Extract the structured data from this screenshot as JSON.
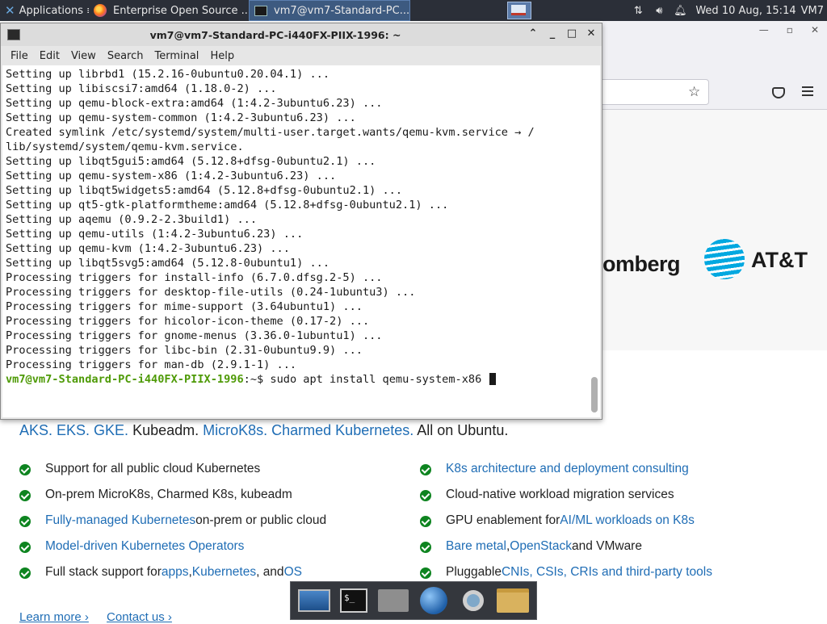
{
  "top_panel": {
    "apps_label": "Applications",
    "apps_suffix": "≡",
    "task_firefox": "Enterprise Open Source ...",
    "task_terminal": "vm7@vm7-Standard-PC...",
    "clock": "Wed 10 Aug, 15:14",
    "user": "VM7",
    "tray_icons": [
      "network-icon",
      "volume-icon",
      "notification-bell-icon"
    ]
  },
  "browser": {
    "logos": {
      "bloomberg_partial": "omberg",
      "att": "AT&T"
    },
    "heading": {
      "part1": "AKS. EKS. GKE.",
      "part2": " Kubeadm. ",
      "part3": "MicroK8s. Charmed Kubernetes.",
      "part4": " All on Ubuntu."
    },
    "features_left": [
      {
        "plain": "Support for all public cloud Kubernetes"
      },
      {
        "plain": "On-prem MicroK8s, Charmed K8s, kubeadm"
      },
      {
        "link": "Fully-managed Kubernetes",
        "plain": " on-prem or public cloud"
      },
      {
        "link": "Model-driven Kubernetes Operators"
      },
      {
        "plain": "Full stack support for ",
        "link": "apps",
        "plain2": ", ",
        "link2": "Kubernetes",
        "plain3": ", and ",
        "link3": "OS"
      }
    ],
    "features_right": [
      {
        "link": "K8s architecture and deployment consulting"
      },
      {
        "plain": "Cloud-native workload migration services"
      },
      {
        "plain": "GPU enablement for ",
        "link": "AI/ML workloads on K8s"
      },
      {
        "link": "Bare metal",
        "plain": ", ",
        "link2": "OpenStack",
        "plain2": " and VMware"
      },
      {
        "plain": "Pluggable ",
        "link": "CNIs, CSIs, CRIs and third-party tools"
      }
    ],
    "learn_more": "Learn more ›",
    "contact_us": "Contact us ›"
  },
  "terminal": {
    "title": "vm7@vm7-Standard-PC-i440FX-PIIX-1996: ~",
    "menu": [
      "File",
      "Edit",
      "View",
      "Search",
      "Terminal",
      "Help"
    ],
    "lines": [
      "Setting up librbd1 (15.2.16-0ubuntu0.20.04.1) ...",
      "Setting up libiscsi7:amd64 (1.18.0-2) ...",
      "Setting up qemu-block-extra:amd64 (1:4.2-3ubuntu6.23) ...",
      "Setting up qemu-system-common (1:4.2-3ubuntu6.23) ...",
      "Created symlink /etc/systemd/system/multi-user.target.wants/qemu-kvm.service → /",
      "lib/systemd/system/qemu-kvm.service.",
      "Setting up libqt5gui5:amd64 (5.12.8+dfsg-0ubuntu2.1) ...",
      "Setting up qemu-system-x86 (1:4.2-3ubuntu6.23) ...",
      "Setting up libqt5widgets5:amd64 (5.12.8+dfsg-0ubuntu2.1) ...",
      "Setting up qt5-gtk-platformtheme:amd64 (5.12.8+dfsg-0ubuntu2.1) ...",
      "Setting up aqemu (0.9.2-2.3build1) ...",
      "Setting up qemu-utils (1:4.2-3ubuntu6.23) ...",
      "Setting up qemu-kvm (1:4.2-3ubuntu6.23) ...",
      "Setting up libqt5svg5:amd64 (5.12.8-0ubuntu1) ...",
      "Processing triggers for install-info (6.7.0.dfsg.2-5) ...",
      "Processing triggers for desktop-file-utils (0.24-1ubuntu3) ...",
      "Processing triggers for mime-support (3.64ubuntu1) ...",
      "Processing triggers for hicolor-icon-theme (0.17-2) ...",
      "Processing triggers for gnome-menus (3.36.0-1ubuntu1) ...",
      "Processing triggers for libc-bin (2.31-0ubuntu9.9) ...",
      "Processing triggers for man-db (2.9.1-1) ..."
    ],
    "prompt_user": "vm7@vm7-Standard-PC-i440FX-PIIX-1996",
    "prompt_suffix": ":~$ ",
    "command": "sudo apt install qemu-system-x86 "
  },
  "dock": {
    "items": [
      "desktop-icon",
      "terminal-icon",
      "home-folder-icon",
      "web-browser-icon",
      "search-icon",
      "files-folder-icon"
    ],
    "terminal_glyph": "$_"
  }
}
